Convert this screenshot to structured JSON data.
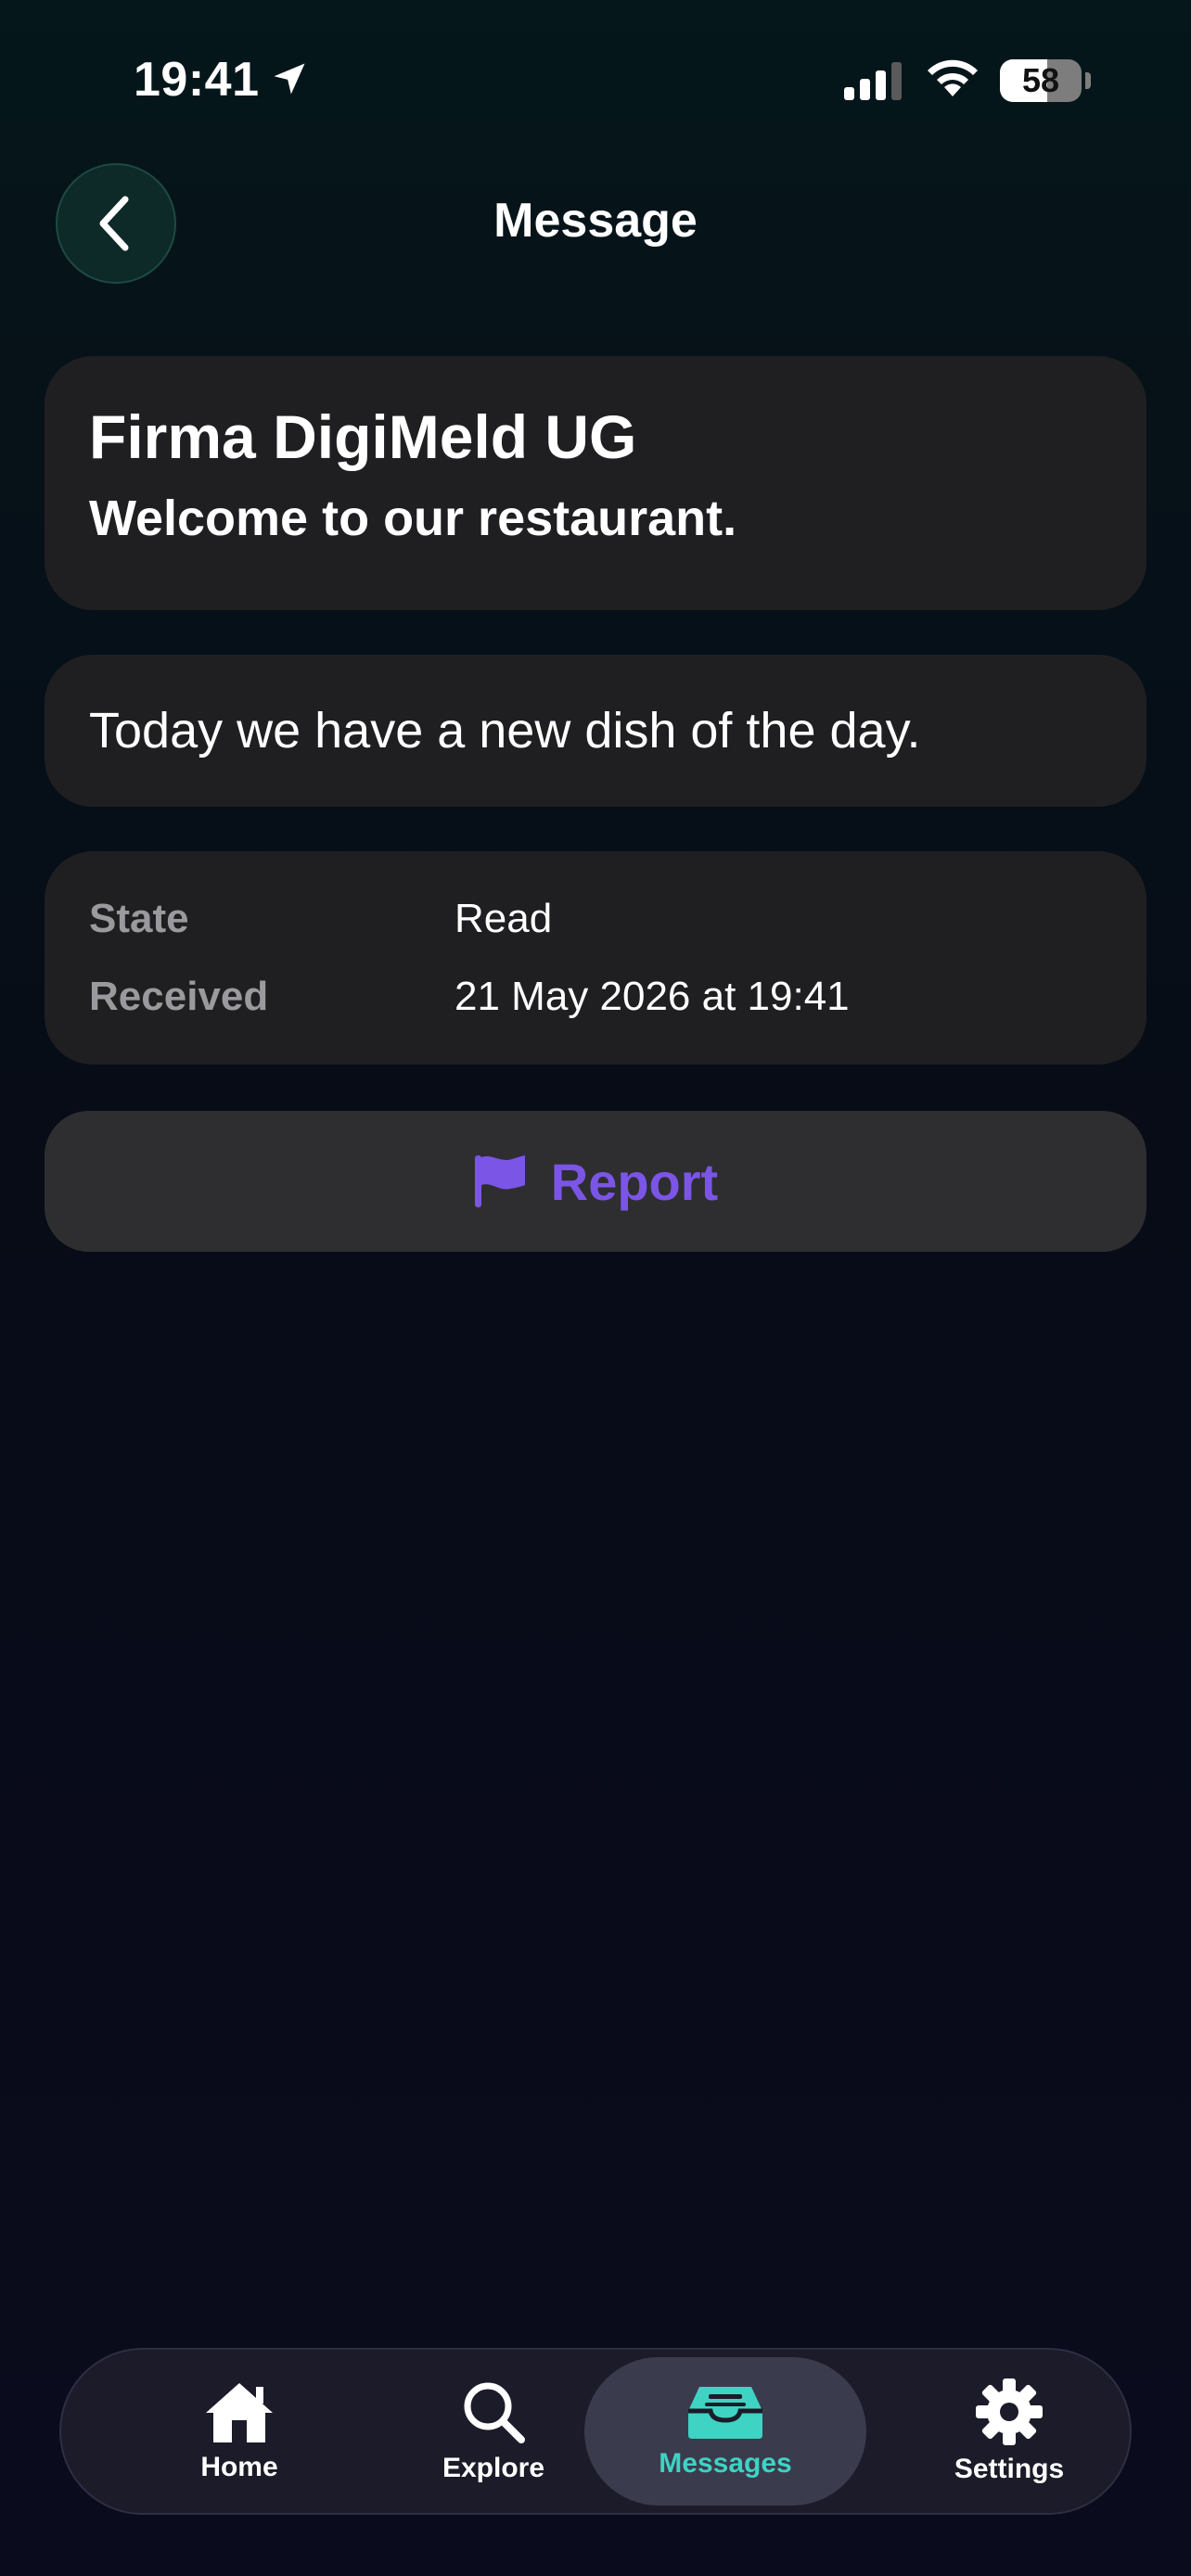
{
  "status_bar": {
    "time": "19:41",
    "battery_level": "58",
    "icons": [
      "location-arrow-icon",
      "cellular-signal-icon",
      "wifi-icon",
      "battery-icon"
    ]
  },
  "nav": {
    "title": "Message",
    "back_icon": "chevron-left-icon"
  },
  "message": {
    "sender": "Firma DigiMeld UG",
    "subject": "Welcome to our restaurant.",
    "body": "Today we have a new dish of the day."
  },
  "meta": {
    "rows": [
      {
        "label": "State",
        "value": "Read"
      },
      {
        "label": "Received",
        "value": "21 May 2026 at 19:41"
      }
    ]
  },
  "report": {
    "label": "Report",
    "icon": "flag-icon",
    "color": "#7b55e6"
  },
  "tab_bar": {
    "active": "Messages",
    "active_color": "#3ed3c3",
    "tabs": [
      {
        "label": "Home",
        "icon": "home-icon"
      },
      {
        "label": "Explore",
        "icon": "search-icon"
      },
      {
        "label": "Messages",
        "icon": "inbox-tray-icon"
      },
      {
        "label": "Settings",
        "icon": "gear-icon"
      }
    ]
  }
}
